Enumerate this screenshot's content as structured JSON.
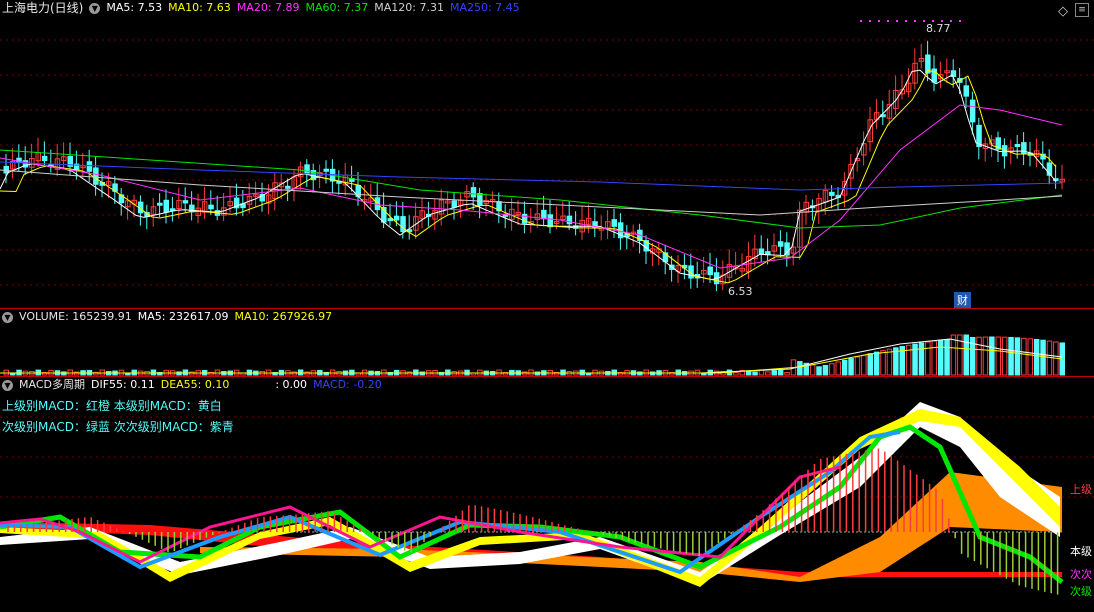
{
  "colors": {
    "up": "#ff3c3c",
    "down": "#54fcfc",
    "ma5": "#ffffff",
    "ma10": "#ffff00",
    "ma20": "#ff33ff",
    "ma60": "#00e600",
    "ma120": "#cfcfcf",
    "ma250": "#3344ff",
    "grid": "#7a0000"
  },
  "header": {
    "stock": "上海电力(日线)",
    "ma5": "MA5: 7.53",
    "ma10": "MA10: 7.63",
    "ma20": "MA20: 7.89",
    "ma60": "MA60: 7.37",
    "ma120": "MA120: 7.31",
    "ma250": "MA250: 7.45",
    "high": "8.77",
    "low": "6.53",
    "badge": "财"
  },
  "volume": {
    "title": "VOLUME: 165239.91",
    "ma5": "MA5: 232617.09",
    "ma10": "MA10: 267926.97"
  },
  "macd": {
    "title": "MACD多周期",
    "dif": "DIF55: 0.11",
    "dea": "DEA55: 0.10",
    "zero": ": 0.00",
    "macd": "MACD: -0.20",
    "legend1": "上级别MACD：红橙  本级别MACD：黄白",
    "legend2": "次级别MACD：绿蓝  次次级别MACD：紫青",
    "tag_upper": "上级",
    "tag_this": "本级",
    "tag_subsub": "次次",
    "tag_sub": "次级"
  },
  "icons": [
    "diamond-icon",
    "menu-icon",
    "collapse-icon"
  ]
}
